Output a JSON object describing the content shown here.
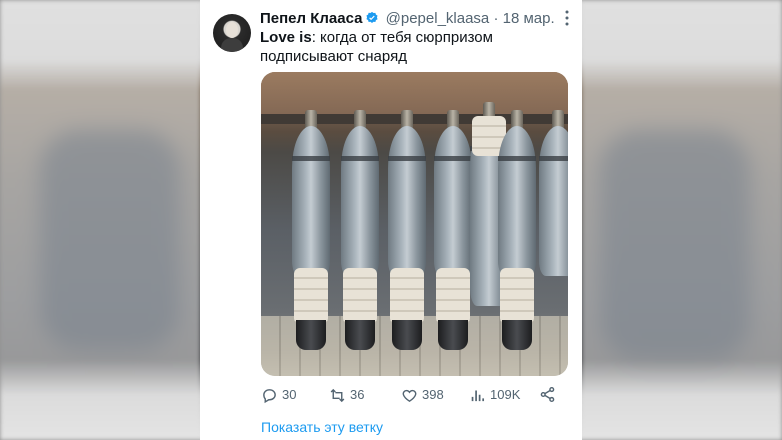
{
  "tweet": {
    "author_name": "Пепел Клааса",
    "handle": "@pepel_klaasa",
    "separator": "·",
    "date": "18 мар.",
    "more_icon": "more-vertical-icon",
    "text_bold": "Love is",
    "text_rest": ": когда от тебя сюрпризом подписывают снаряд",
    "verified_color": "#1d9bf0"
  },
  "actions": {
    "replies": "30",
    "retweets": "36",
    "likes": "398",
    "views": "109K"
  },
  "thread_link": "Показать эту ветку",
  "colors": {
    "link": "#1d9bf0",
    "muted": "#536471",
    "text": "#0f1419"
  }
}
